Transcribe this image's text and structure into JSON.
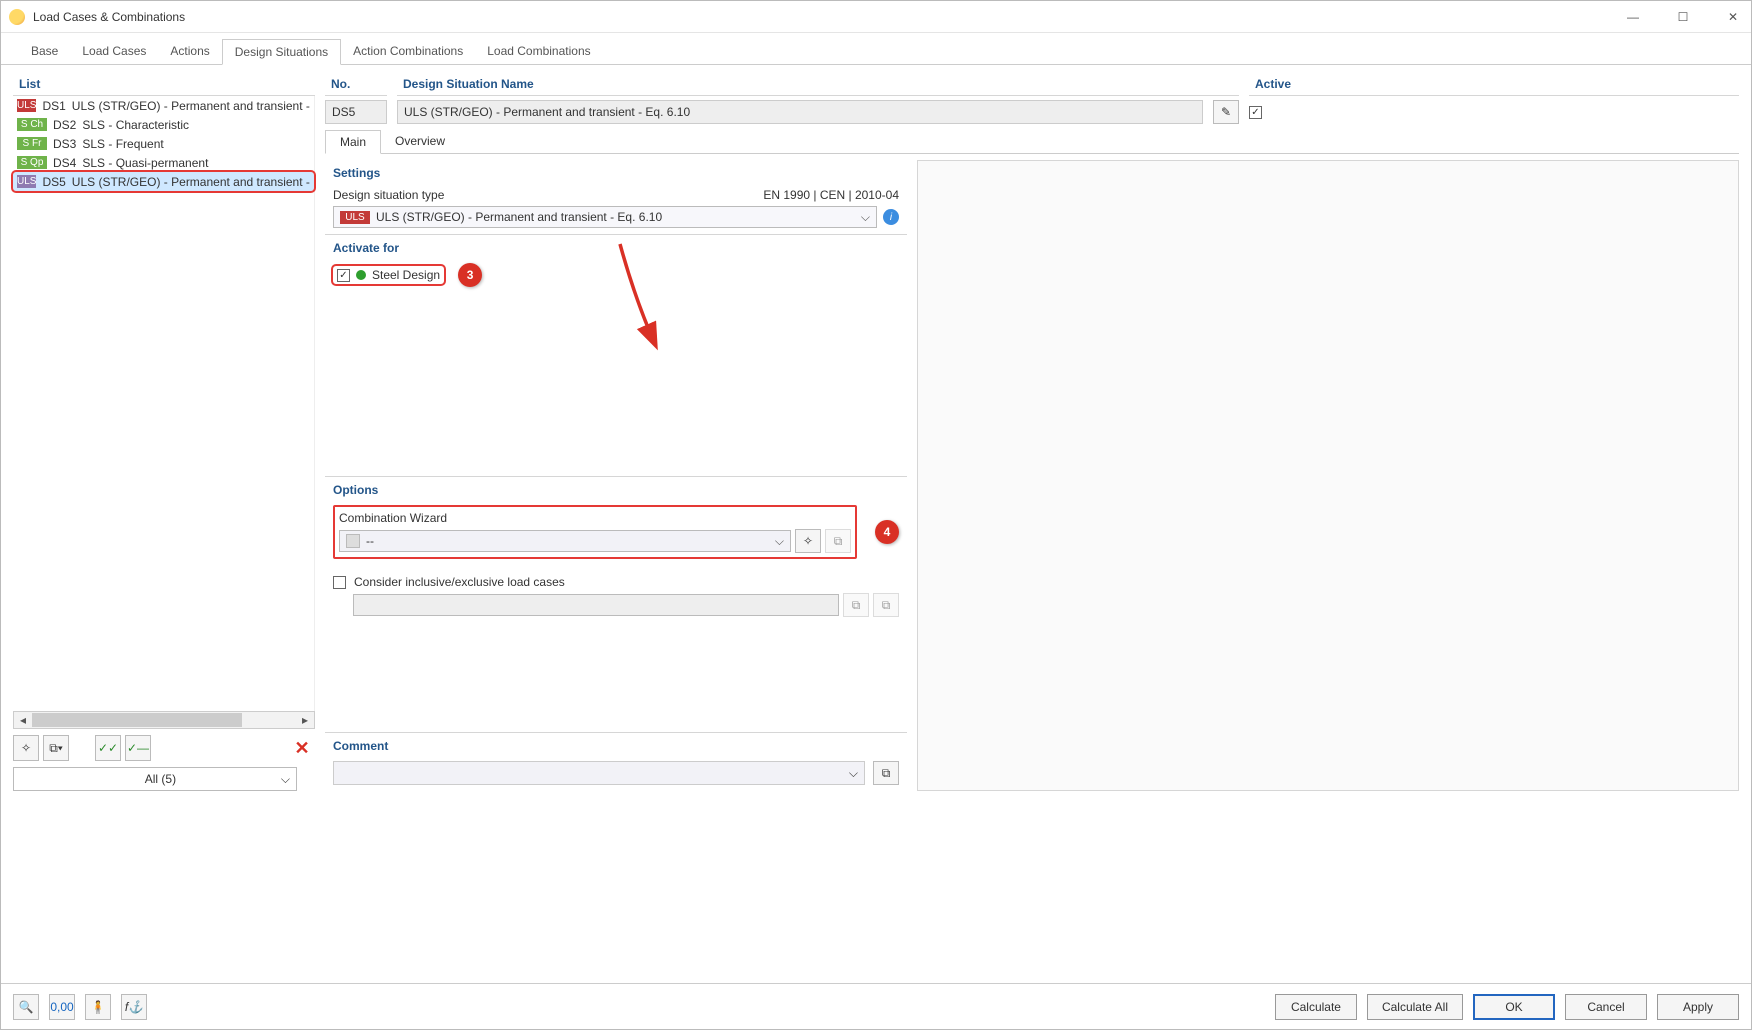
{
  "window": {
    "title": "Load Cases & Combinations"
  },
  "tabs": [
    "Base",
    "Load Cases",
    "Actions",
    "Design Situations",
    "Action Combinations",
    "Load Combinations"
  ],
  "active_tab_index": 3,
  "list": {
    "header": "List",
    "items": [
      {
        "badge": "ULS",
        "color": "#c33a38",
        "code": "DS1",
        "text": "ULS (STR/GEO) - Permanent and transient - Eq."
      },
      {
        "badge": "S Ch",
        "color": "#6fb34a",
        "code": "DS2",
        "text": "SLS - Characteristic"
      },
      {
        "badge": "S Fr",
        "color": "#6fb34a",
        "code": "DS3",
        "text": "SLS - Frequent"
      },
      {
        "badge": "S Qp",
        "color": "#6fb34a",
        "code": "DS4",
        "text": "SLS - Quasi-permanent"
      },
      {
        "badge": "ULS",
        "color": "#8f7bb1",
        "code": "DS5",
        "text": "ULS (STR/GEO) - Permanent and transient - Eq."
      }
    ],
    "selected_index": 4,
    "filter": "All (5)"
  },
  "form": {
    "no_label": "No.",
    "no_value": "DS5",
    "name_label": "Design Situation Name",
    "name_value": "ULS (STR/GEO) - Permanent and transient - Eq. 6.10",
    "active_label": "Active",
    "active_checked": true,
    "sub_tabs": [
      "Main",
      "Overview"
    ],
    "sub_active": 0
  },
  "settings": {
    "title": "Settings",
    "type_label": "Design situation type",
    "standard": "EN 1990 | CEN | 2010-04",
    "badge": "ULS",
    "badge_color": "#c33a38",
    "combo_value": "ULS (STR/GEO) - Permanent and transient - Eq. 6.10"
  },
  "activate": {
    "title": "Activate for",
    "steel_label": "Steel Design",
    "steel_checked": true,
    "badge_3": "3"
  },
  "options": {
    "title": "Options",
    "wizard_label": "Combination Wizard",
    "wizard_value": "--",
    "badge_4": "4",
    "consider_label": "Consider inclusive/exclusive load cases",
    "consider_checked": false
  },
  "comment": {
    "title": "Comment"
  },
  "footer": {
    "calculate": "Calculate",
    "calculate_all": "Calculate All",
    "ok": "OK",
    "cancel": "Cancel",
    "apply": "Apply"
  }
}
